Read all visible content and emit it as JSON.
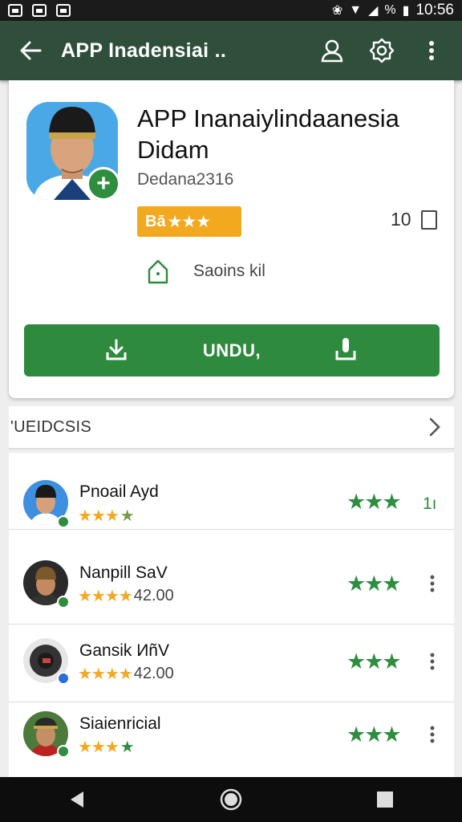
{
  "status_bar": {
    "time": "10:56",
    "battery_label": "%"
  },
  "app_bar": {
    "title": "APP Inadensiai .."
  },
  "app": {
    "name": "APP Inanaiylindaanesia Didam",
    "developer": "Dedana2316",
    "rating_badge_text": "Bā",
    "rating_badge_stars": "★★★",
    "count": "10",
    "saving_text": "Saoins kil",
    "install_label": "UNDU,"
  },
  "section": {
    "title": "'UEIDCSIS"
  },
  "reviews": [
    {
      "name": "Pnoail Ayd",
      "stars": "★★★",
      "half": "★",
      "value": "",
      "right_stars": "★★★",
      "right_text": "1ı"
    },
    {
      "name": "Nanpill SaV",
      "stars": "★★★★",
      "half": "",
      "value": "42.00",
      "right_stars": "★★★",
      "right_text": ""
    },
    {
      "name": "Gansik ИñV",
      "stars": "★★★★",
      "half": "",
      "value": "42.00",
      "right_stars": "★★★",
      "right_text": ""
    },
    {
      "name": "Siaienricial",
      "stars": "★★★",
      "half": "★",
      "value": "",
      "right_stars": "★★★",
      "right_text": ""
    }
  ],
  "colors": {
    "app_bar": "#2f4f3a",
    "primary_green": "#2e8a3d",
    "rating_orange": "#f2a81f",
    "status_bar": "#1b1b1b"
  },
  "icons": {
    "back": "back-arrow-icon",
    "account": "account-icon",
    "settings": "settings-icon",
    "more": "more-vert-icon",
    "home": "home-icon",
    "download": "download-icon",
    "chevron": "chevron-right-icon"
  }
}
